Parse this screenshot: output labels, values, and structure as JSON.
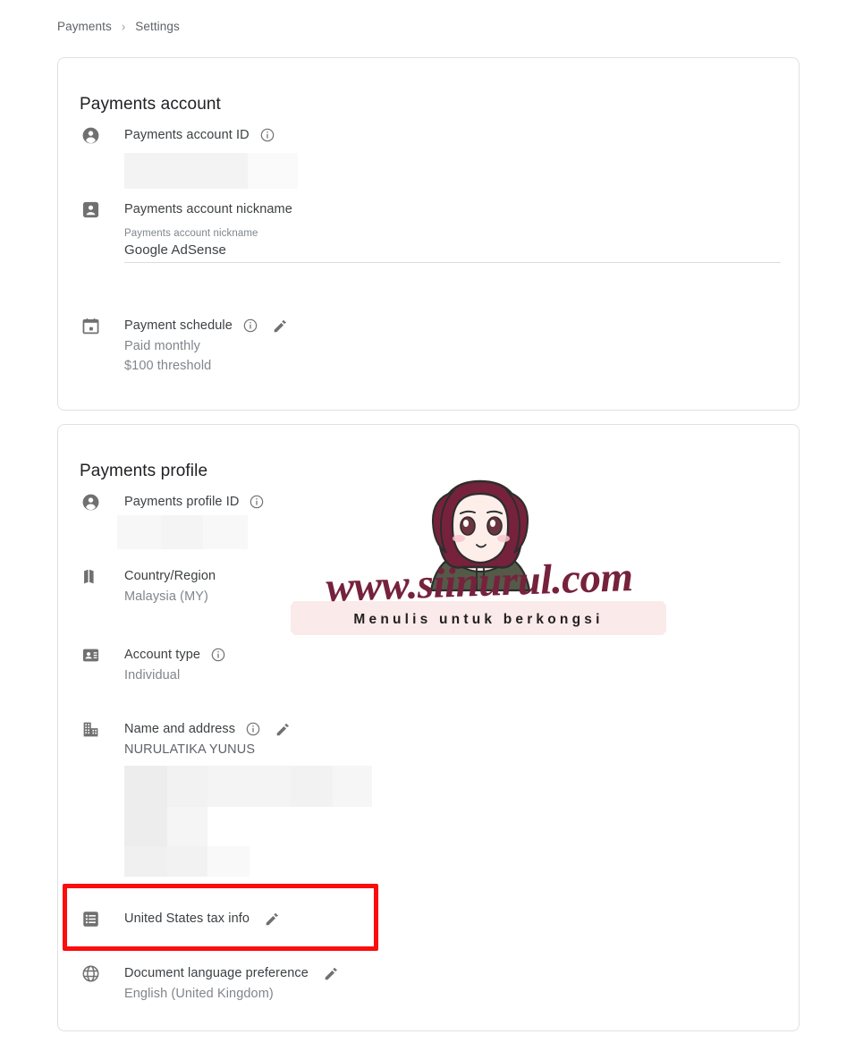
{
  "breadcrumb": {
    "items": [
      {
        "label": "Payments"
      },
      {
        "label": "Settings"
      }
    ],
    "separator": "›"
  },
  "payments_account": {
    "title": "Payments account",
    "account_id": {
      "label": "Payments account ID",
      "icon": "account-circle-icon",
      "info_icon": "info-icon",
      "value": "",
      "redacted": true
    },
    "nickname": {
      "label": "Payments account nickname",
      "icon": "account-box-icon",
      "field_label": "Payments account nickname",
      "field_value": "Google AdSense"
    },
    "payment_schedule": {
      "label": "Payment schedule",
      "icon": "calendar-icon",
      "info_icon": "info-icon",
      "edit_icon": "pencil-icon",
      "value_line1": "Paid monthly",
      "value_line2": "$100 threshold"
    }
  },
  "payments_profile": {
    "title": "Payments profile",
    "profile_id": {
      "label": "Payments profile ID",
      "icon": "account-circle-icon",
      "info_icon": "info-icon",
      "value": "",
      "redacted": true
    },
    "country_region": {
      "label": "Country/Region",
      "icon": "map-icon",
      "value": "Malaysia (MY)"
    },
    "account_type": {
      "label": "Account type",
      "icon": "contact-card-icon",
      "info_icon": "info-icon",
      "value": "Individual"
    },
    "name_and_address": {
      "label": "Name and address",
      "icon": "building-icon",
      "info_icon": "info-icon",
      "edit_icon": "pencil-icon",
      "name": "NURULATIKA YUNUS",
      "address_redacted": true
    },
    "us_tax_info": {
      "label": "United States tax info",
      "icon": "list-icon",
      "edit_icon": "pencil-icon",
      "highlighted": true,
      "highlight_color": "#fc0d0d"
    },
    "document_language": {
      "label": "Document language preference",
      "icon": "globe-icon",
      "edit_icon": "pencil-icon",
      "value": "English (United Kingdom)"
    }
  },
  "watermark": {
    "url_text": "www.siinurul.com",
    "tagline": "Menulis untuk berkongsi",
    "accent_color": "#76223c",
    "banner_color": "#fbeaea"
  },
  "colors": {
    "icon_gray": "#707070",
    "text_primary": "#3c4043",
    "text_secondary": "#80868b",
    "card_border": "#dfe1e5",
    "highlight_red": "#fc0d0d"
  }
}
